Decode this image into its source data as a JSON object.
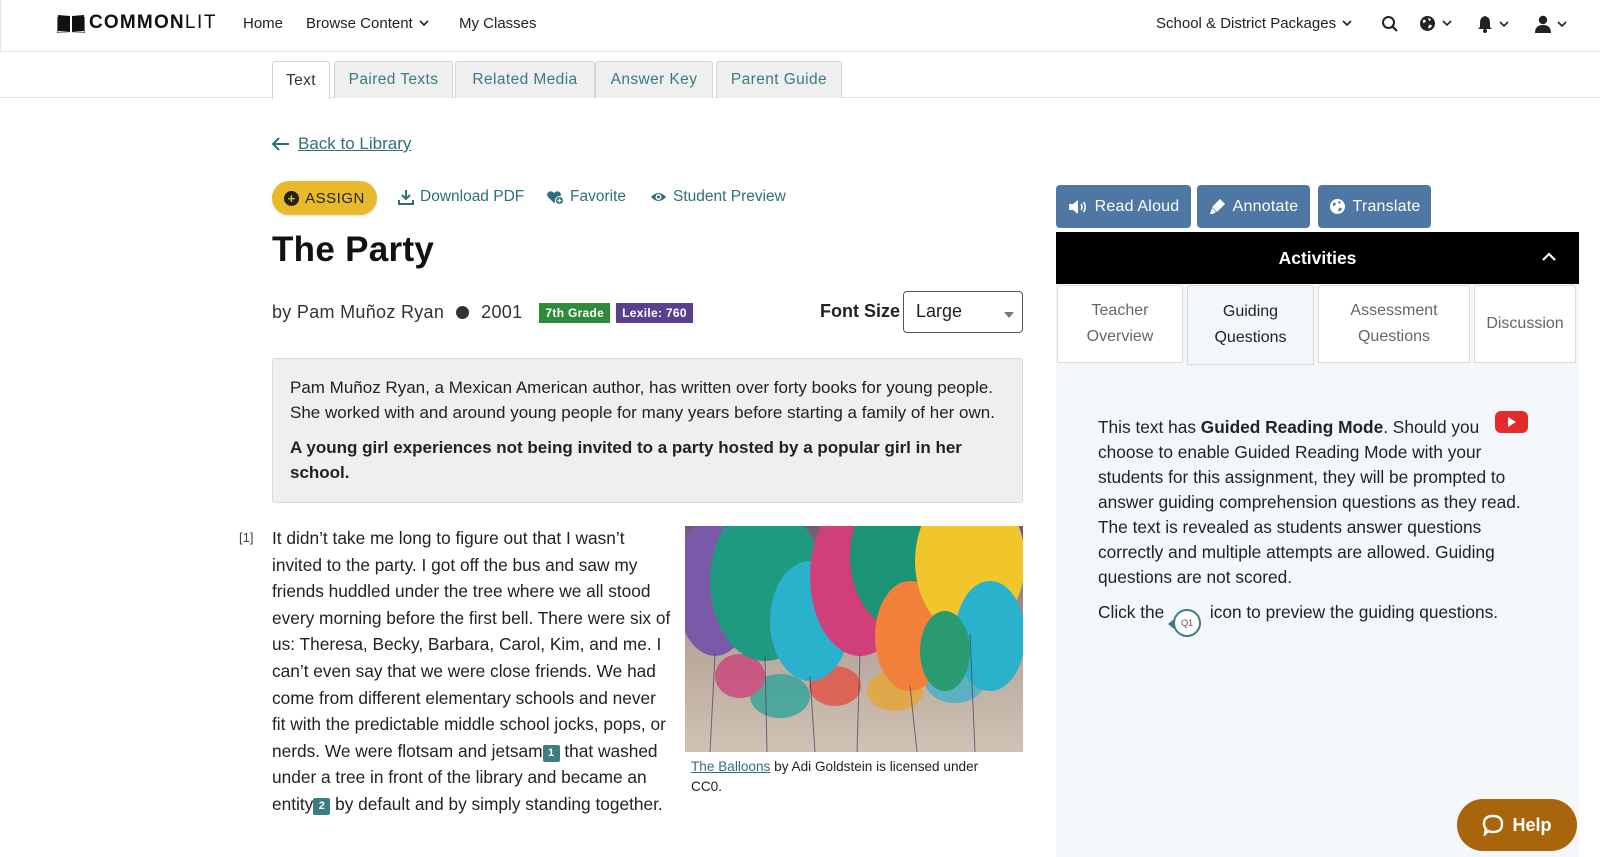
{
  "nav": {
    "logo_bold": "COMMON",
    "logo_light": "LIT",
    "links": [
      {
        "label": "Home",
        "has_dropdown": false
      },
      {
        "label": "Browse Content",
        "has_dropdown": true
      },
      {
        "label": "My Classes",
        "has_dropdown": false
      }
    ],
    "packages_label": "School & District Packages",
    "icons": [
      "search-icon",
      "globe-icon",
      "bell-icon",
      "user-icon"
    ]
  },
  "tabs": [
    {
      "label": "Text",
      "active": true
    },
    {
      "label": "Paired Texts",
      "active": false
    },
    {
      "label": "Related Media",
      "active": false
    },
    {
      "label": "Answer Key",
      "active": false
    },
    {
      "label": "Parent Guide",
      "active": false
    }
  ],
  "back_label": " Back to Library",
  "actions": {
    "assign": "ASSIGN",
    "download": "Download PDF",
    "favorite": "Favorite",
    "preview": "Student Preview"
  },
  "text": {
    "title": "The Party",
    "author": "by Pam Muñoz Ryan",
    "year": "2001",
    "grade_badge": "7th Grade",
    "lexile_badge": "Lexile: 760",
    "grade_color": "#2e8b3a",
    "lexile_color": "#5b3f8f"
  },
  "font_size": {
    "label": "Font Size",
    "value": "Large"
  },
  "intro": {
    "bio": "Pam Muñoz Ryan, a Mexican American author, has written over forty books for young people. She worked with and around young people for many years before starting a family of her own.",
    "summary": "A young girl experiences not being invited to a party hosted by a popular girl in her school."
  },
  "passage": {
    "number": "[1]",
    "part1": "It didn’t take me long to figure out that I wasn’t invited to the party. I got off the bus and saw my friends huddled under the tree where we all stood every morning before the first bell. There were six of us: Theresa, Becky, Barbara, Carol, Kim, and me. I can’t even say that we were close friends. We had come from different elementary schools and never fit with the predictable middle school jocks, pops, or nerds. We were flotsam and jetsam",
    "fn1": "1",
    "part2": " that washed under a tree in front of the library and became an entity",
    "fn2": "2",
    "part3": " by default and by simply standing together."
  },
  "image_caption": {
    "link": "The Balloons",
    "rest": " by Adi Goldstein is licensed under CC0."
  },
  "tools": {
    "read_aloud": "Read Aloud",
    "annotate": "Annotate",
    "translate": "Translate"
  },
  "activities": {
    "header": "Activities",
    "tabs": [
      {
        "line1": "Teacher",
        "line2": "Overview",
        "active": false
      },
      {
        "line1": "Guiding",
        "line2": "Questions",
        "active": true
      },
      {
        "line1": "Assessment",
        "line2": "Questions",
        "active": false
      },
      {
        "line1": "Discussion",
        "line2": "",
        "active": false
      }
    ],
    "gq_pre": "This text has ",
    "gq_bold": "Guided Reading Mode",
    "gq_post": ". Should you choose to enable Guided Reading Mode with your students for this assignment, they will be prompted to answer guiding comprehension questions as they read. The text is revealed as students answer questions correctly and multiple attempts are allowed. Guiding questions are not scored.",
    "click_pre": "Click the ",
    "q1_label": "Q1",
    "click_post": " icon to preview the guiding questions."
  },
  "help_label": "Help"
}
